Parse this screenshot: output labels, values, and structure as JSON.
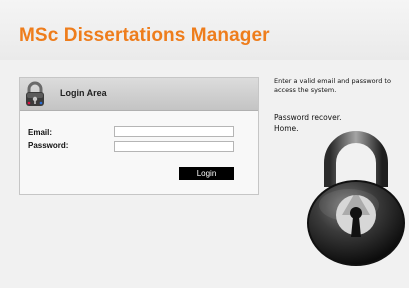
{
  "header": {
    "title": "MSc Dissertations Manager"
  },
  "login": {
    "title": "Login Area",
    "email_label": "Email:",
    "password_label": "Password:",
    "email_value": "",
    "password_value": "",
    "button_label": "Login",
    "lock_icon": "padlock-icon"
  },
  "info": {
    "text": "Enter a valid email and password to access the system.",
    "links": [
      {
        "label": "Password recover."
      },
      {
        "label": "Home."
      }
    ]
  },
  "decor": {
    "illustration": "large-padlock-icon"
  },
  "colors": {
    "title": "#ee7d1c",
    "button_bg": "#000000",
    "button_text": "#ffffff",
    "content_bg": "#f1f1f1"
  }
}
